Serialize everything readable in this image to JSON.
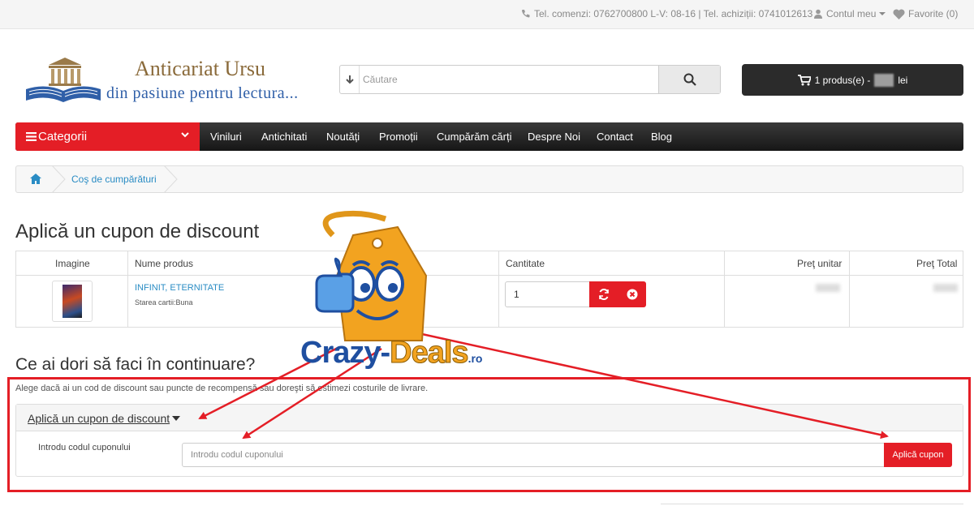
{
  "topbar": {
    "phone_text": "Tel. comenzi: 0762700800 L-V: 08-16 | Tel. achiziții: 0741012613",
    "account_label": "Contul meu",
    "favorites_label": "Favorite (0)"
  },
  "logo": {
    "line1": "Anticariat Ursu",
    "line2": "din pasiune pentru lectura..."
  },
  "search": {
    "placeholder": "Căutare"
  },
  "cart": {
    "label": "1 produs(e) -",
    "currency": "lei"
  },
  "nav": {
    "categories_label": "Categorii",
    "items": [
      "Viniluri",
      "Antichitati",
      "Noutăți",
      "Promoții",
      "Cumpărăm cărți",
      "Despre Noi",
      "Contact",
      "Blog"
    ]
  },
  "breadcrumb": {
    "cart_label": "Coş de cumpărături"
  },
  "page_title": "Aplică un cupon de discount",
  "table": {
    "headers": [
      "Imagine",
      "Nume produs",
      "Cantitate",
      "Preţ unitar",
      "Preţ Total"
    ],
    "rows": [
      {
        "name": "INFINIT, ETERNITATE",
        "state": "Starea cartii:Buna",
        "quantity": "1"
      }
    ]
  },
  "next_section": {
    "title": "Ce ai dori să faci în continuare?",
    "info": "Alege dacă ai un cod de discount sau puncte de recompensă sau doreşti să estimezi costurile de livrare."
  },
  "coupon": {
    "panel_title": "Aplică un cupon de discount",
    "label": "Introdu codul cuponului",
    "placeholder": "Introdu codul cuponului",
    "button": "Aplică cupon"
  },
  "watermark": {
    "part1": "Crazy-",
    "part2": "Deals",
    "part3": ".ro"
  },
  "colors": {
    "accent": "#e41e26",
    "link": "#2a8cc4",
    "nav_bg": "#222222",
    "cart_bg": "#2b2b2b"
  }
}
